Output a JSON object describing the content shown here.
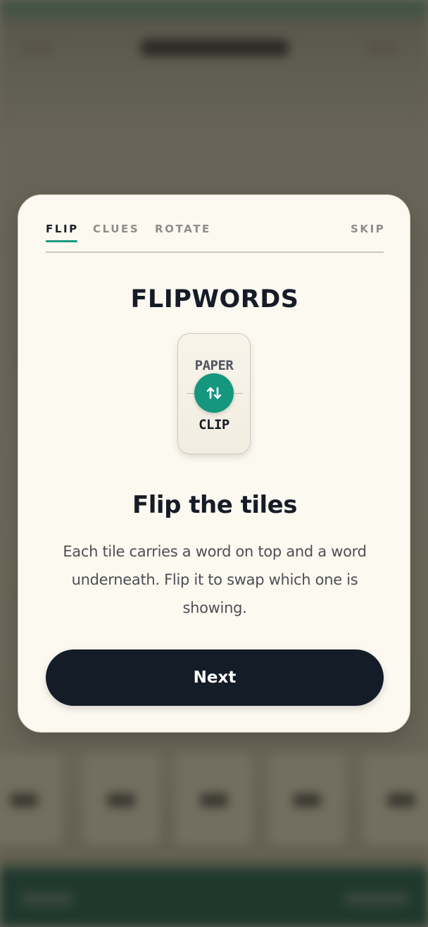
{
  "tabs": [
    {
      "label": "FLIP",
      "active": true
    },
    {
      "label": "CLUES",
      "active": false
    },
    {
      "label": "ROTATE",
      "active": false
    }
  ],
  "skip_label": "SKIP",
  "brand_title": "FLIPWORDS",
  "tile": {
    "top_word": "PAPER",
    "bottom_word": "CLIP",
    "icon": "flip-arrows-icon"
  },
  "headline": "Flip the tiles",
  "description": "Each tile carries a word on top and a word underneath. Flip it to swap which one is showing.",
  "next_label": "Next",
  "colors": {
    "accent": "#169a84",
    "button": "#141c27",
    "card": "#fcf9f1"
  }
}
